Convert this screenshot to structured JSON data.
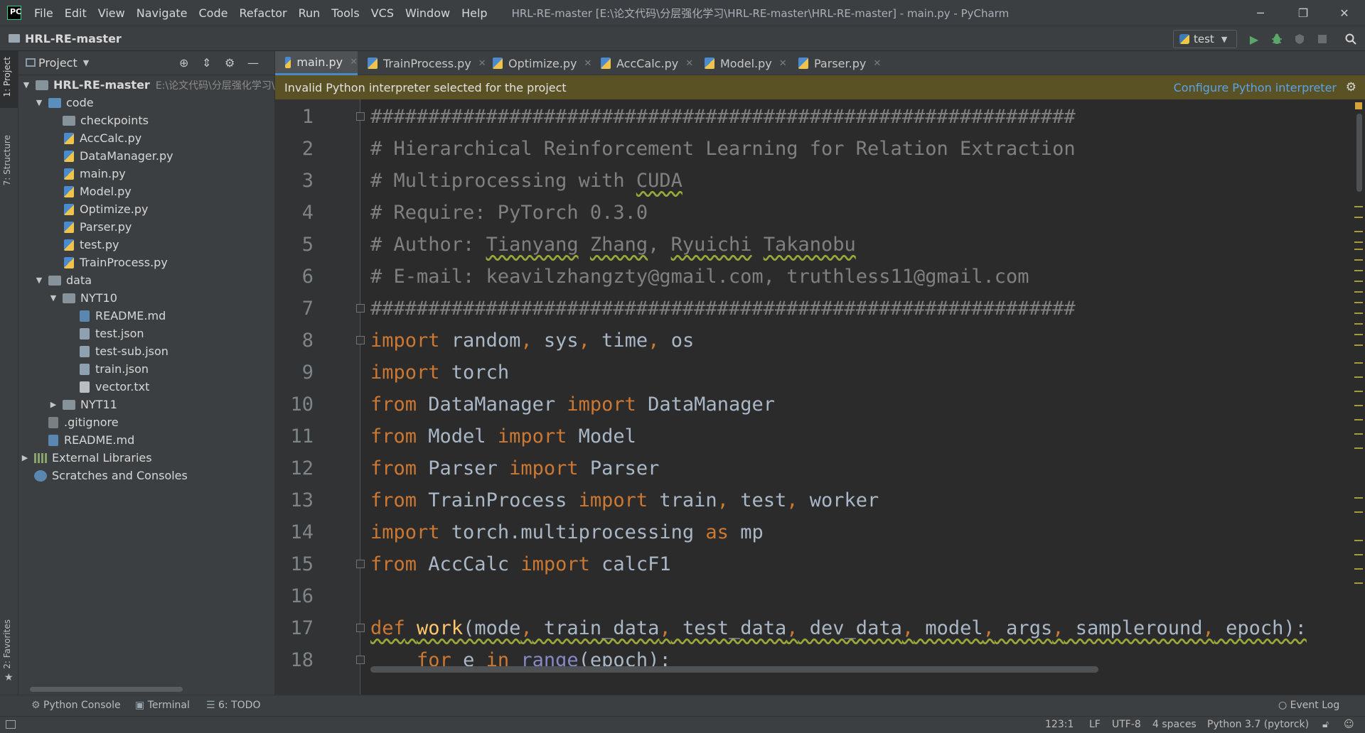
{
  "app": {
    "logo_text": "PC"
  },
  "menu": [
    "File",
    "Edit",
    "View",
    "Navigate",
    "Code",
    "Refactor",
    "Run",
    "Tools",
    "VCS",
    "Window",
    "Help"
  ],
  "window_title": "HRL-RE-master [E:\\论文代码\\分层强化学习\\HRL-RE-master\\HRL-RE-master] - main.py - PyCharm",
  "window_controls": {
    "minimize": "─",
    "restore": "❐",
    "close": "✕"
  },
  "navbar": {
    "project_name": "HRL-RE-master",
    "run_config": "test"
  },
  "left_stripe": {
    "project_tab": "1: Project",
    "structure_tab": "7: Structure",
    "favorites_tab": "2: Favorites"
  },
  "project_panel": {
    "header": "Project",
    "tree": [
      {
        "label": "HRL-RE-master",
        "path": "E:\\论文代码\\分层强化学习\\H",
        "type": "root-folder",
        "expanded": true
      },
      {
        "label": "code",
        "type": "folder-blue",
        "expanded": true
      },
      {
        "label": "checkpoints",
        "type": "folder"
      },
      {
        "label": "AccCalc.py",
        "type": "py"
      },
      {
        "label": "DataManager.py",
        "type": "py"
      },
      {
        "label": "main.py",
        "type": "py"
      },
      {
        "label": "Model.py",
        "type": "py"
      },
      {
        "label": "Optimize.py",
        "type": "py"
      },
      {
        "label": "Parser.py",
        "type": "py"
      },
      {
        "label": "test.py",
        "type": "py"
      },
      {
        "label": "TrainProcess.py",
        "type": "py"
      },
      {
        "label": "data",
        "type": "folder",
        "expanded": true
      },
      {
        "label": "NYT10",
        "type": "folder",
        "expanded": true
      },
      {
        "label": "README.md",
        "type": "md"
      },
      {
        "label": "test.json",
        "type": "json"
      },
      {
        "label": "test-sub.json",
        "type": "json"
      },
      {
        "label": "train.json",
        "type": "json"
      },
      {
        "label": "vector.txt",
        "type": "txt"
      },
      {
        "label": "NYT11",
        "type": "folder",
        "expanded": false
      },
      {
        "label": ".gitignore",
        "type": "git"
      },
      {
        "label": "README.md",
        "type": "md"
      },
      {
        "label": "External Libraries",
        "type": "libs",
        "expanded": false
      },
      {
        "label": "Scratches and Consoles",
        "type": "scratch"
      }
    ]
  },
  "tabs": [
    {
      "label": "main.py",
      "active": true
    },
    {
      "label": "TrainProcess.py"
    },
    {
      "label": "Optimize.py"
    },
    {
      "label": "AccCalc.py"
    },
    {
      "label": "Model.py"
    },
    {
      "label": "Parser.py"
    }
  ],
  "banner": {
    "message": "Invalid Python interpreter selected for the project",
    "link": "Configure Python interpreter",
    "color": "#5a5224"
  },
  "editor": {
    "line_numbers": [
      "1",
      "2",
      "3",
      "4",
      "5",
      "6",
      "7",
      "8",
      "9",
      "10",
      "11",
      "12",
      "13",
      "14",
      "15",
      "16",
      "17",
      "18"
    ],
    "lines": [
      "#############################################################",
      "# Hierarchical Reinforcement Learning for Relation Extraction",
      "# Multiprocessing with CUDA",
      "# Require: PyTorch 0.3.0",
      "# Author: Tianyang Zhang, Ryuichi Takanobu",
      "# E-mail: keavilzhangzty@gmail.com, truthless11@gmail.com",
      "#############################################################",
      "import random, sys, time, os",
      "import torch",
      "from DataManager import DataManager",
      "from Model import Model",
      "from Parser import Parser",
      "from TrainProcess import train, test, worker",
      "import torch.multiprocessing as mp",
      "from AccCalc import calcF1",
      "",
      "def work(mode, train_data, test_data, dev_data, model, args, sampleround, epoch):",
      "    for e in range(epoch):"
    ]
  },
  "bottom_tools": {
    "python_console": "Python Console",
    "terminal": "Terminal",
    "todo": "6: TODO",
    "event_log": "Event Log"
  },
  "status": {
    "position": "123:1",
    "line_sep": "LF",
    "encoding": "UTF-8",
    "indent": "4 spaces",
    "interpreter": "Python 3.7 (pytorck)"
  },
  "colors": {
    "keyword": "#cc7832",
    "comment": "#808080",
    "function": "#ffc66d",
    "builtin": "#8888c6",
    "accent": "#4a88c7",
    "link": "#5ba3e6"
  }
}
